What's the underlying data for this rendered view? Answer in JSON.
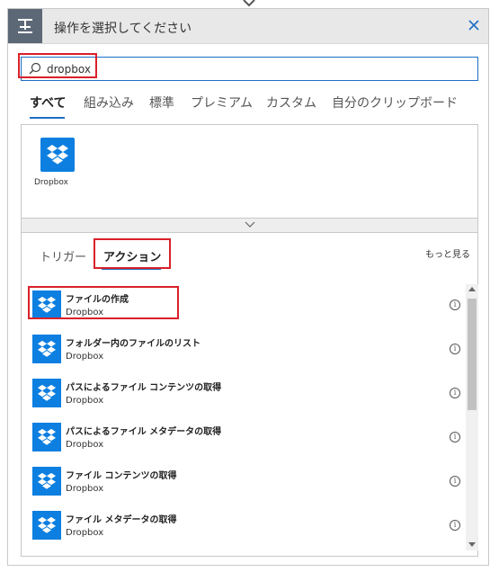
{
  "header": {
    "title": "操作を選択してください",
    "icon": "trigger-action-icon",
    "close_icon": "close-icon"
  },
  "search": {
    "value": "dropbox",
    "icon": "search-icon"
  },
  "tabs": [
    {
      "label": "すべて",
      "active": true
    },
    {
      "label": "組み込み"
    },
    {
      "label": "標準"
    },
    {
      "label": "プレミアム"
    },
    {
      "label": "カスタム"
    },
    {
      "label": "自分のクリップボード"
    }
  ],
  "connector": {
    "label": "Dropbox",
    "icon": "dropbox-icon"
  },
  "subtabs": [
    {
      "label": "トリガー"
    },
    {
      "label": "アクション",
      "active": true
    }
  ],
  "more_label": "もっと見る",
  "actions": [
    {
      "title": "ファイルの作成",
      "connector": "Dropbox"
    },
    {
      "title": "フォルダー内のファイルのリスト",
      "connector": "Dropbox"
    },
    {
      "title": "パスによるファイル コンテンツの取得",
      "connector": "Dropbox"
    },
    {
      "title": "パスによるファイル メタデータの取得",
      "connector": "Dropbox"
    },
    {
      "title": "ファイル コンテンツの取得",
      "connector": "Dropbox"
    },
    {
      "title": "ファイル メタデータの取得",
      "connector": "Dropbox"
    }
  ],
  "colors": {
    "accent": "#1d6fc5",
    "highlight": "#d9202a",
    "dropbox": "#0d7fe0",
    "header": "#e8e8e8"
  }
}
